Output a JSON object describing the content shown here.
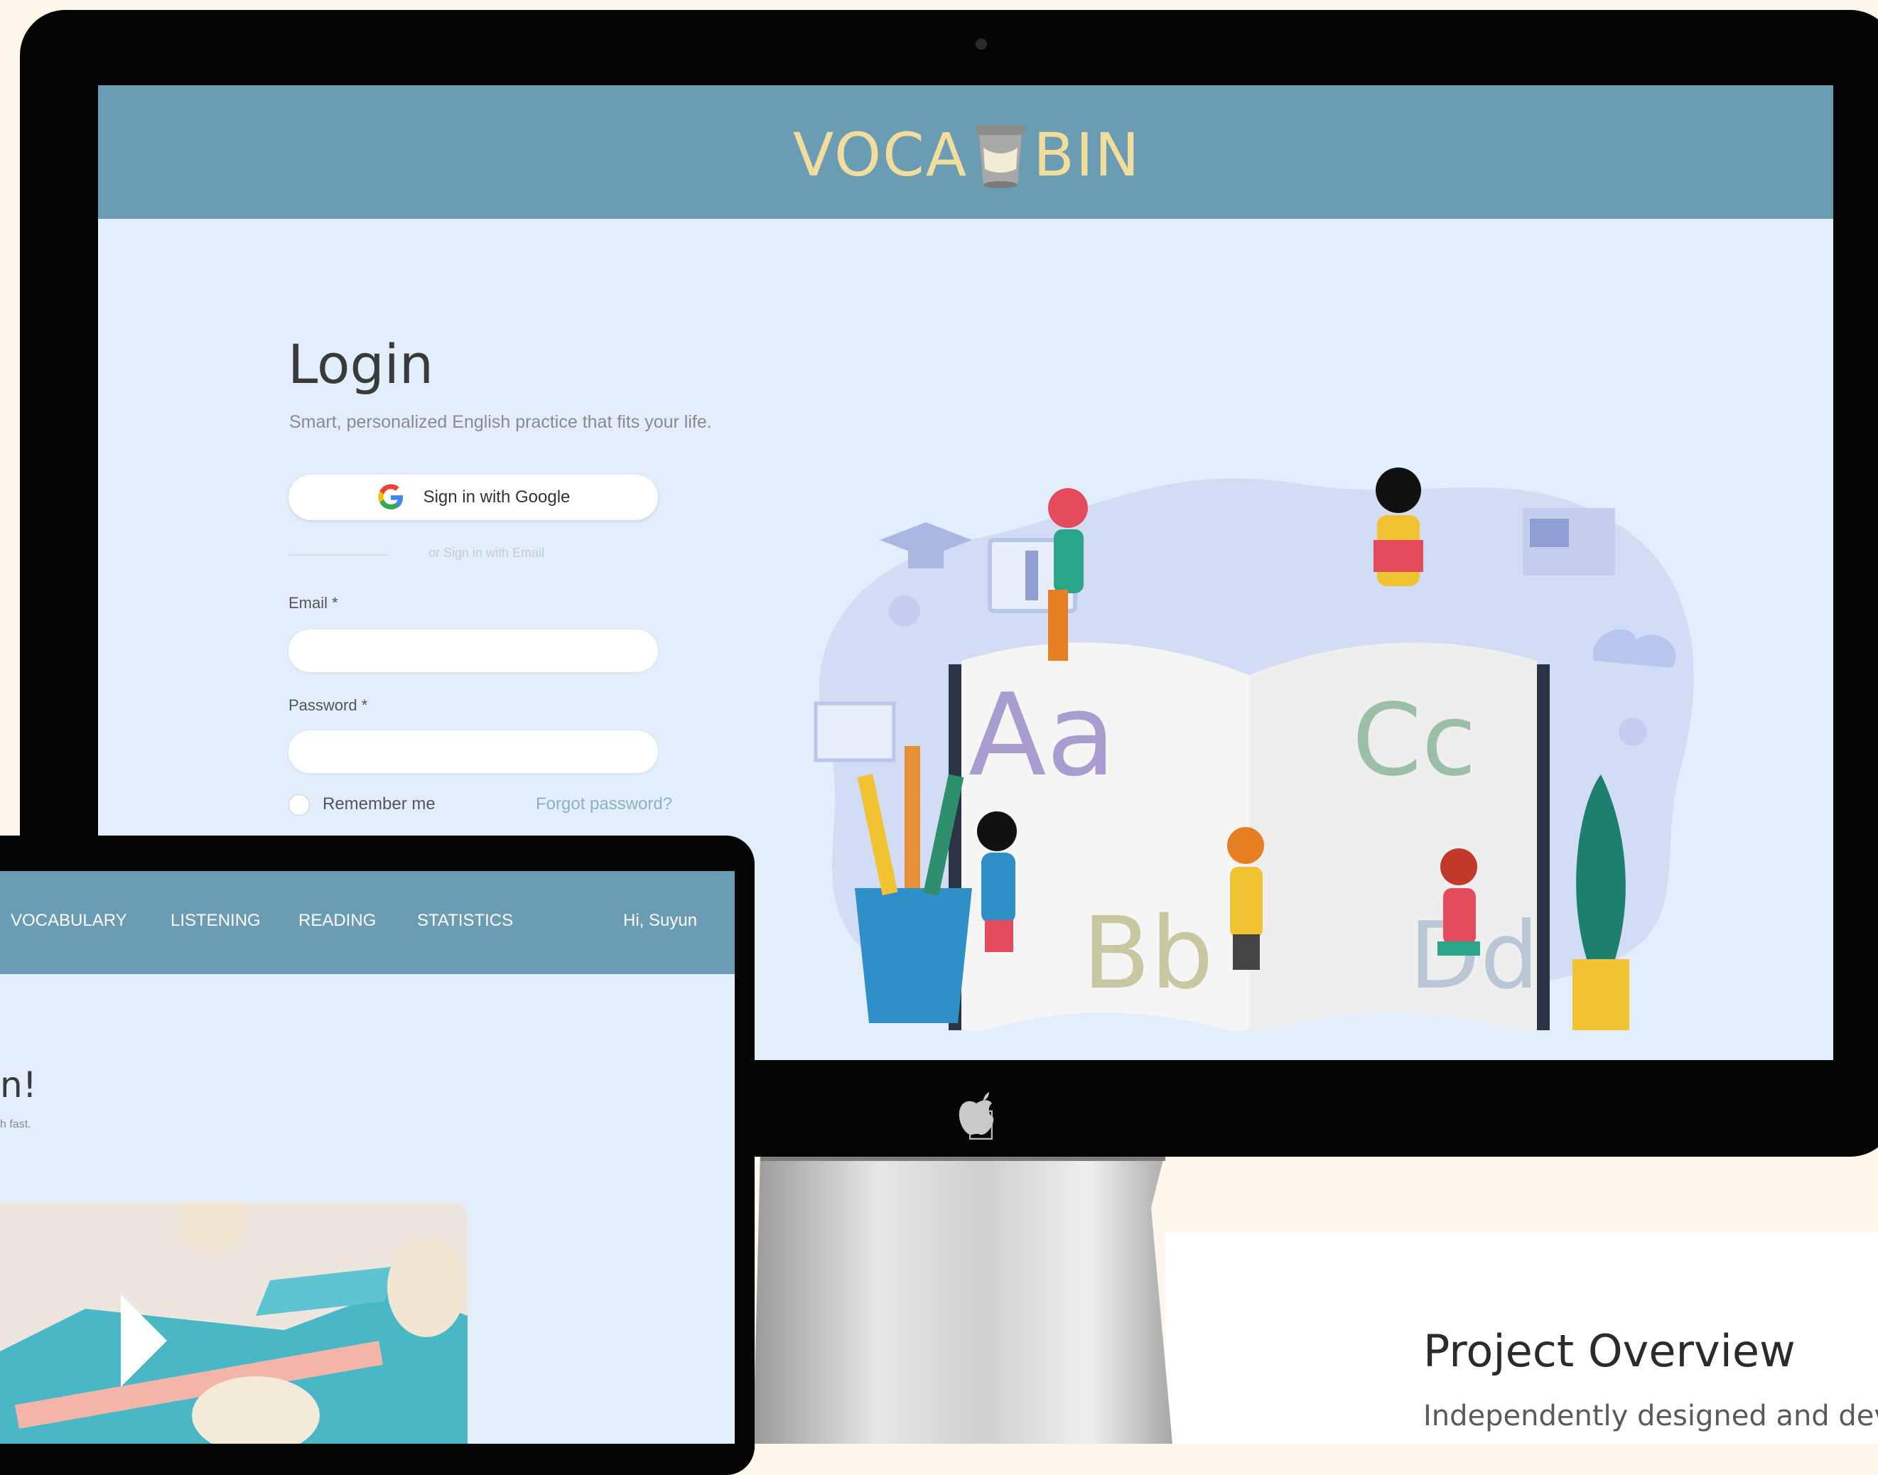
{
  "overview": {
    "title": "Project Overview",
    "text": "Independently designed and develo"
  },
  "site": {
    "logo_left": "VOCA",
    "logo_right": "BIN",
    "logo_icon": "trash-bin-icon"
  },
  "login": {
    "title": "Login",
    "subtitle": "Smart, personalized English practice that fits your life.",
    "google_button": "Sign in with Google",
    "divider_text": "or Sign in with Email",
    "email_label": "Email *",
    "password_label": "Password *",
    "email_value": "",
    "password_value": "",
    "remember_label": "Remember me",
    "forgot_label": "Forgot password?",
    "illustration_letters": [
      "Aa",
      "Bb",
      "Cc",
      "Dd"
    ]
  },
  "laptop": {
    "nav": [
      "VOCABULARY",
      "LISTENING",
      "READING",
      "STATISTICS"
    ],
    "greeting_user": "Hi, Suyun",
    "hello_text": "n!",
    "small_text": "h fast."
  },
  "colors": {
    "header": "#6a9db3",
    "screen_bg": "#e3eefc",
    "logo": "#f2dd9c",
    "page_bg": "#fdf6ea"
  },
  "icons": [
    "google-icon",
    "apple-logo-icon",
    "play-icon",
    "trash-bin-icon"
  ]
}
